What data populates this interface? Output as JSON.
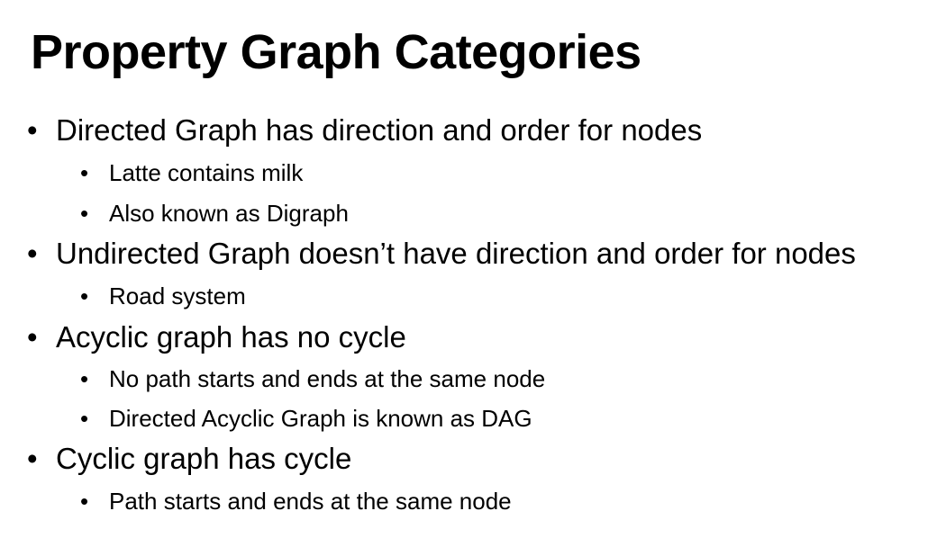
{
  "slide": {
    "title": "Property Graph Categories",
    "bullets": [
      {
        "text": "Directed  Graph has direction and order for nodes",
        "sub": [
          "Latte contains milk",
          "Also known as Digraph"
        ]
      },
      {
        "text": "Undirected Graph doesn’t have direction and order for nodes",
        "sub": [
          "Road system"
        ]
      },
      {
        "text": "Acyclic graph has no cycle",
        "sub": [
          "No path starts and ends at the same node",
          "Directed Acyclic Graph is known as DAG"
        ]
      },
      {
        "text": "Cyclic graph has cycle",
        "sub": [
          "Path starts and ends at the same node"
        ]
      }
    ],
    "bullet_glyph": "•"
  }
}
